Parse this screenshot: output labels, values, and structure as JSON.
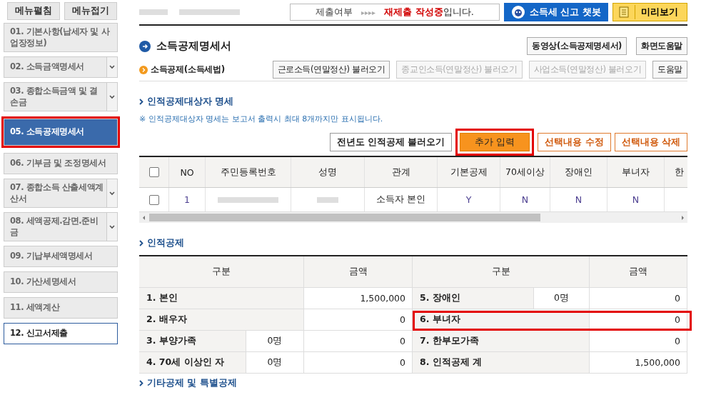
{
  "sidebar": {
    "buttons": [
      "메뉴펼침",
      "메뉴접기"
    ],
    "items": [
      {
        "label": "01. 기본사항(납세자 및 사업장정보)",
        "expandable": false,
        "selected": false,
        "highlighted": false
      },
      {
        "label": "02. 소득금액명세서",
        "expandable": true,
        "selected": false,
        "highlighted": false
      },
      {
        "label": "03. 종합소득금액 및 결손금",
        "expandable": true,
        "selected": false,
        "highlighted": false
      },
      {
        "label": "05. 소득공제명세서",
        "expandable": false,
        "selected": true,
        "highlighted": true
      },
      {
        "label": "06. 기부금 및 조정명세서",
        "expandable": false,
        "selected": false,
        "highlighted": false
      },
      {
        "label": "07. 종합소득 산출세액계산서",
        "expandable": true,
        "selected": false,
        "highlighted": false
      },
      {
        "label": "08. 세액공제.감면.준비금",
        "expandable": true,
        "selected": false,
        "highlighted": false
      },
      {
        "label": "09. 기납부세액명세서",
        "expandable": false,
        "selected": false,
        "highlighted": false
      },
      {
        "label": "10. 가산세명세서",
        "expandable": false,
        "selected": false,
        "highlighted": false
      },
      {
        "label": "11. 세액계산",
        "expandable": false,
        "selected": false,
        "highlighted": false
      },
      {
        "label": "12. 신고서제출",
        "expandable": false,
        "selected": false,
        "highlighted": false,
        "current": true
      }
    ]
  },
  "status": {
    "label": "제출여부",
    "arrows": "▸▸▸▸",
    "text": "**재제출 작성중**입니다."
  },
  "chatbot_button": "소득세 신고 챗봇",
  "preview_button": "미리보기",
  "page_title": "소득공제명세서",
  "page_buttons": [
    "동영상(소득공제명세서)",
    "화면도움말"
  ],
  "subsection": {
    "title": "소득공제(소득세법)",
    "buttons": [
      {
        "label": "근로소득(연말정산) 불러오기",
        "disabled": false
      },
      {
        "label": "종교인소득(연말정산) 불러오기",
        "disabled": true
      },
      {
        "label": "사업소득(연말정산) 불러오기",
        "disabled": true
      },
      {
        "label": "도움말",
        "disabled": false
      }
    ]
  },
  "dependents": {
    "title": "인적공제대상자 명세",
    "note": "※ 인적공제대상자 명세는 보고서 출력시 최대 8개까지만 표시됩니다.",
    "select_all_checked": false,
    "buttons": [
      {
        "label": "전년도 인적공제 불러오기",
        "kind": "plain",
        "highlighted": false
      },
      {
        "label": "추가 입력",
        "kind": "primary",
        "highlighted": true
      },
      {
        "label": "선택내용 수정",
        "kind": "outline",
        "highlighted": false
      },
      {
        "label": "선택내용 삭제",
        "kind": "outline",
        "highlighted": false
      }
    ],
    "columns": [
      "NO",
      "주민등록번호",
      "성명",
      "관계",
      "기본공제",
      "70세이상",
      "장애인",
      "부녀자",
      "한"
    ],
    "rows": [
      {
        "checked": false,
        "no": "1",
        "relation": "소득자 본인",
        "basic": "Y",
        "over70": "N",
        "disabled_person": "N",
        "female_head": "N"
      }
    ]
  },
  "deductions": {
    "title": "인적공제",
    "headers": [
      "구분",
      "금액",
      "구분",
      "금액"
    ],
    "rows": [
      {
        "left_label": "1. 본인",
        "left_amount": "1,500,000",
        "right_label": "5. 장애인",
        "right_count": "0명",
        "right_amount": "0",
        "highlighted": false
      },
      {
        "left_label": "2. 배우자",
        "left_amount": "0",
        "right_label": "6. 부녀자",
        "right_amount": "0",
        "highlighted": true
      },
      {
        "left_label": "3. 부양가족",
        "left_count": "0명",
        "left_amount": "0",
        "right_label": "7. 한부모가족",
        "right_amount": "0",
        "highlighted": false
      },
      {
        "left_label": "4. 70세 이상인 자",
        "left_count": "0명",
        "left_amount": "0",
        "right_label": "8. 인적공제 계",
        "right_amount": "1,500,000",
        "highlighted": false
      }
    ]
  },
  "next_section": "기타공제 및 특별공제"
}
